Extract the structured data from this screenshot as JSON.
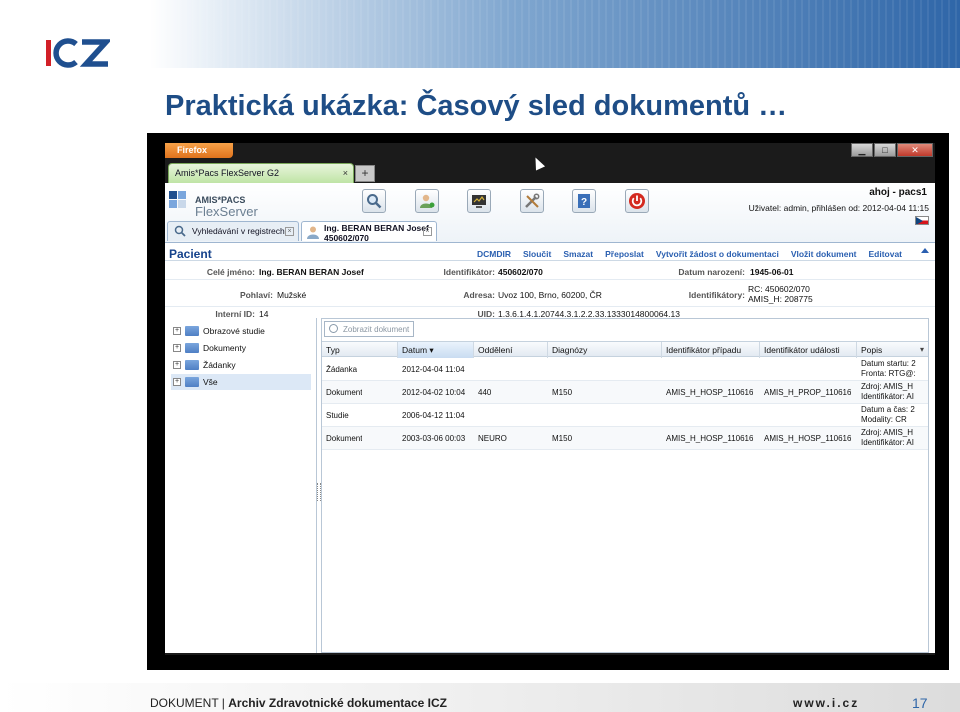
{
  "slide": {
    "logo_text": "ICZ",
    "title": "Praktická ukázka: Časový sled dokumentů …",
    "footer_doc": "DOKUMENT |",
    "footer_doc_bold": "Archiv Zdravotnické dokumentace ICZ",
    "footer_url": "www.i.cz",
    "page_number": "17"
  },
  "browser": {
    "menu_button": "Firefox",
    "tab_title": "Amis*Pacs FlexServer G2",
    "tab_close": "×",
    "new_tab": "+",
    "win_min": "▁",
    "win_max": "□",
    "win_close": "✕"
  },
  "app": {
    "name_line1": "AMIS*PACS",
    "name_line2": "FlexServer",
    "user_name": "ahoj - pacs1",
    "user_info": "Uživatel: admin, přihlášen od: 2012-04-04 11:15",
    "toolbar_icons": [
      "search-icon",
      "user-add-icon",
      "monitor-icon",
      "tools-icon",
      "help-icon",
      "power-icon"
    ],
    "subtabs": {
      "search": "Vyhledávání v registrech",
      "patient_line1": "Ing. BERAN BERAN Josef",
      "patient_line2": "450602/070",
      "close": "×"
    }
  },
  "patient": {
    "title": "Pacient",
    "actions": [
      "DCMDIR",
      "Sloučit",
      "Smazat",
      "Přeposlat",
      "Vytvořit žádost o dokumentaci",
      "Vložit dokument",
      "Editovat"
    ],
    "full_name_label": "Celé jméno:",
    "full_name": "Ing. BERAN BERAN Josef",
    "identifier_label": "Identifikátor:",
    "identifier": "450602/070",
    "birth_label": "Datum narození:",
    "birth": "1945-06-01",
    "sex_label": "Pohlaví:",
    "sex": "Mužské",
    "address_label": "Adresa:",
    "address": "Uvoz 100, Brno, 60200, ČR",
    "ids_label": "Identifikátory:",
    "ids_line1": "RC: 450602/070",
    "ids_line2": "AMIS_H: 208775",
    "internal_label": "Interní ID:",
    "internal": "14",
    "uid_label": "UID:",
    "uid": "1.3.6.1.4.1.20744.3.1.2.2.33.1333014800064.13"
  },
  "tree": {
    "expand": "+",
    "items": [
      "Obrazové studie",
      "Dokumenty",
      "Žádanky",
      "Vše"
    ]
  },
  "grid": {
    "search_placeholder": "Zobrazit dokument",
    "columns": [
      "Typ",
      "Datum",
      "Oddělení",
      "Diagnózy",
      "Identifikátor případu",
      "Identifikátor události",
      "Popis"
    ],
    "sort_indicator": "▾",
    "rows": [
      {
        "typ": "Žádanka",
        "datum": "2012-04-04 11:04",
        "oddeleni": "",
        "diagnozy": "",
        "pripad": "",
        "udalost": "",
        "popis1": "Datum startu: 2",
        "popis2": "Fronta: RTG@:"
      },
      {
        "typ": "Dokument",
        "datum": "2012-04-02 10:04",
        "oddeleni": "440",
        "diagnozy": "M150",
        "pripad": "AMIS_H_HOSP_110616",
        "udalost": "AMIS_H_PROP_110616",
        "popis1": "Zdroj: AMIS_H",
        "popis2": "Identifikátor: AI"
      },
      {
        "typ": "Studie",
        "datum": "2006-04-12 11:04",
        "oddeleni": "",
        "diagnozy": "",
        "pripad": "",
        "udalost": "",
        "popis1": "Datum a čas: 2",
        "popis2": "Modality: CR"
      },
      {
        "typ": "Dokument",
        "datum": "2003-03-06 00:03",
        "oddeleni": "NEURO",
        "diagnozy": "M150",
        "pripad": "AMIS_H_HOSP_110616",
        "udalost": "AMIS_H_HOSP_110616",
        "popis1": "Zdroj: AMIS_H",
        "popis2": "Identifikátor: AI"
      }
    ]
  },
  "colors": {
    "title_blue": "#1e4d86",
    "link_blue": "#2a5fb0",
    "firefox_orange": "#e0731d",
    "logo_red": "#d22027",
    "logo_blue": "#1f4f8f"
  }
}
